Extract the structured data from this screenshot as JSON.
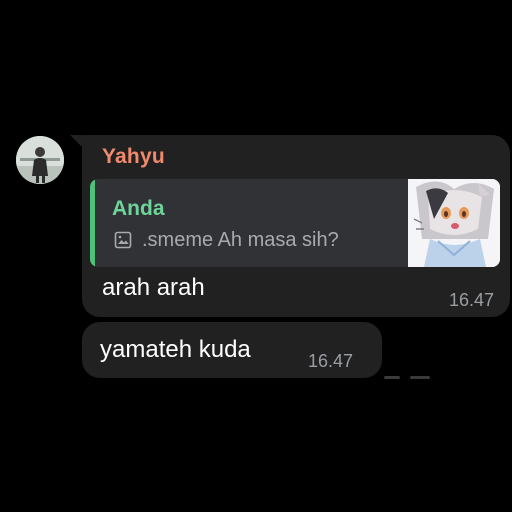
{
  "messages": [
    {
      "sender": "Yahyu",
      "reply": {
        "name": "Anda",
        "text": ".smeme Ah masa sih?"
      },
      "text": "arah arah",
      "time": "16.47"
    },
    {
      "text": "yamateh kuda",
      "time": "16.47"
    }
  ],
  "colors": {
    "background": "#000000",
    "bubble": "#212121",
    "reply_background": "#303236",
    "sender_name": "#f08a6c",
    "reply_name": "#6fd49a",
    "reply_bar": "#4fc27a",
    "time": "#9a9ea3"
  },
  "icons": {
    "reply_media": "image-icon"
  }
}
